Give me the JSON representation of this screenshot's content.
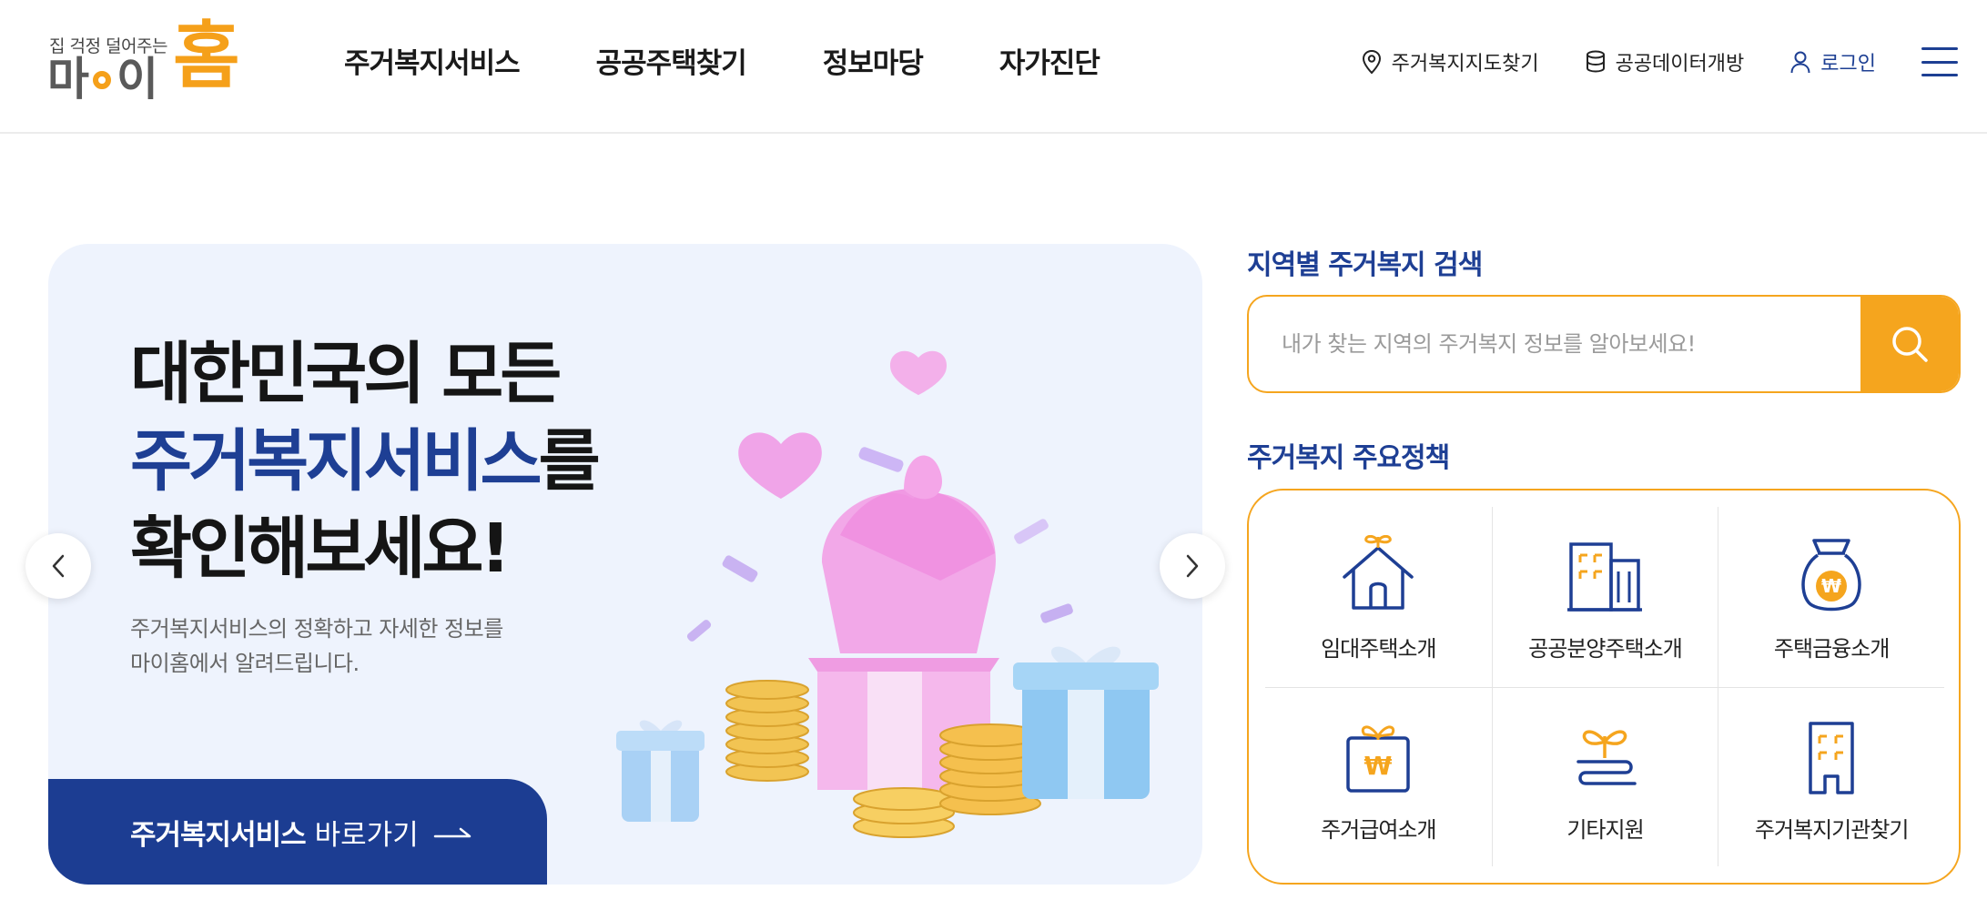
{
  "header": {
    "logo": {
      "tagline": "집 걱정 덜어주는",
      "name_part1": "마",
      "name_part2": "이",
      "name_part3": "홈"
    },
    "nav": [
      {
        "label": "주거복지서비스"
      },
      {
        "label": "공공주택찾기"
      },
      {
        "label": "정보마당"
      },
      {
        "label": "자가진단"
      }
    ],
    "util": {
      "map_label": "주거복지지도찾기",
      "data_label": "공공데이터개방",
      "login_label": "로그인"
    }
  },
  "hero": {
    "title_line1": "대한민국의 모든",
    "title_accent": "주거복지서비스",
    "title_suffix": "를",
    "title_line3": "확인해보세요!",
    "desc_line1": "주거복지서비스의 정확하고 자세한 정보를",
    "desc_line2": "마이홈에서 알려드립니다.",
    "cta_bold": "주거복지서비스",
    "cta_rest": "바로가기"
  },
  "search": {
    "title": "지역별 주거복지 검색",
    "placeholder": "내가 찾는 지역의 주거복지 정보를 알아보세요!"
  },
  "policy": {
    "title": "주거복지 주요정책",
    "items": [
      {
        "label": "임대주택소개",
        "icon": "house-sprout-icon"
      },
      {
        "label": "공공분양주택소개",
        "icon": "buildings-icon"
      },
      {
        "label": "주택금융소개",
        "icon": "money-bag-icon"
      },
      {
        "label": "주거급여소개",
        "icon": "gift-won-icon"
      },
      {
        "label": "기타지원",
        "icon": "sprout-hand-icon"
      },
      {
        "label": "주거복지기관찾기",
        "icon": "office-building-icon"
      }
    ]
  },
  "colors": {
    "primary": "#1e3f94",
    "accent": "#f5a51e",
    "hero_bg": "#eef3fd"
  }
}
